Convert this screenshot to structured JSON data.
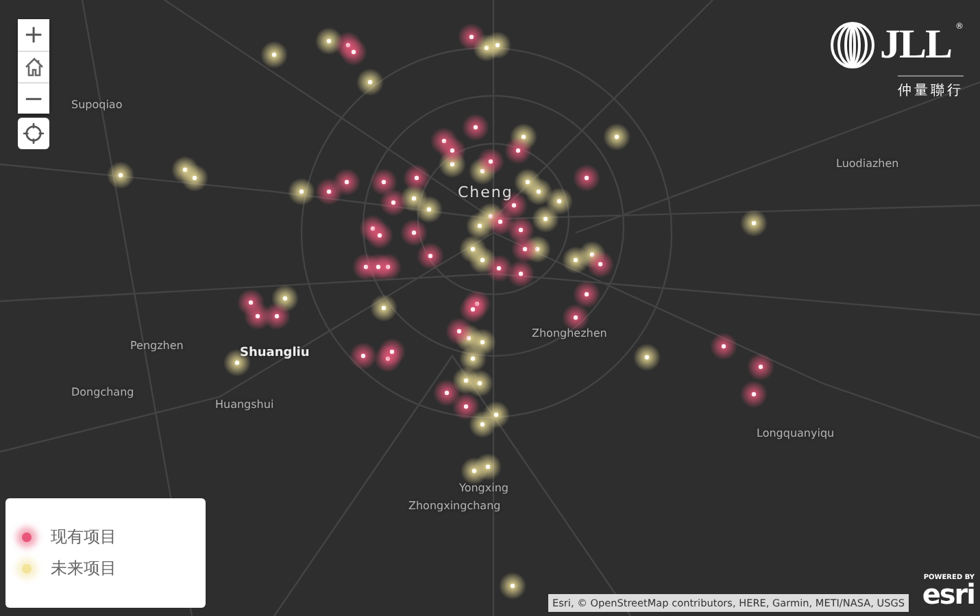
{
  "map_controls": {
    "zoom_in": "+",
    "zoom_out": "−"
  },
  "logo": {
    "wordmark": "JLL",
    "registered": "®",
    "chinese_name": "仲量聯行"
  },
  "map": {
    "labels": [
      "Supoqiao",
      "Luodiazhen",
      "Cheng",
      "Pengzhen",
      "Shuangliu",
      "Zhonghezhen",
      "Dongchang",
      "Huangshui",
      "Longquanyiqu",
      "Yongxing",
      "Zhongxingchang"
    ]
  },
  "legend": {
    "items": [
      {
        "label": "现有项目",
        "color": "#e8577a"
      },
      {
        "label": "未来项目",
        "color": "#f3e49a"
      }
    ]
  },
  "attribution": "Esri, © OpenStreetMap contributors, HERE, Garmin, METI/NASA, USGS",
  "powered_by": {
    "caption": "POWERED BY",
    "brand": "esri"
  }
}
